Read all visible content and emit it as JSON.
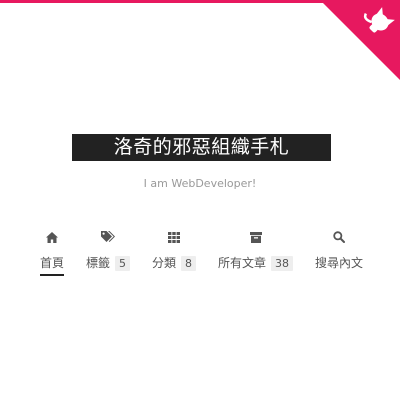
{
  "site": {
    "title": "洛奇的邪惡組織手札",
    "subtitle": "I am WebDeveloper!"
  },
  "colors": {
    "accent": "#e7185f",
    "brand_bg": "#222222",
    "badge_bg": "#eeeeee"
  },
  "menu": {
    "items": [
      {
        "label": "首頁",
        "icon": "home-icon",
        "active": true
      },
      {
        "label": "標籤",
        "icon": "tags-icon",
        "count": "5"
      },
      {
        "label": "分類",
        "icon": "th-icon",
        "count": "8"
      },
      {
        "label": "所有文章",
        "icon": "archive-icon",
        "count": "38"
      },
      {
        "label": "搜尋內文",
        "icon": "search-icon"
      }
    ]
  },
  "github_corner": {
    "icon": "github-octocat-icon"
  }
}
